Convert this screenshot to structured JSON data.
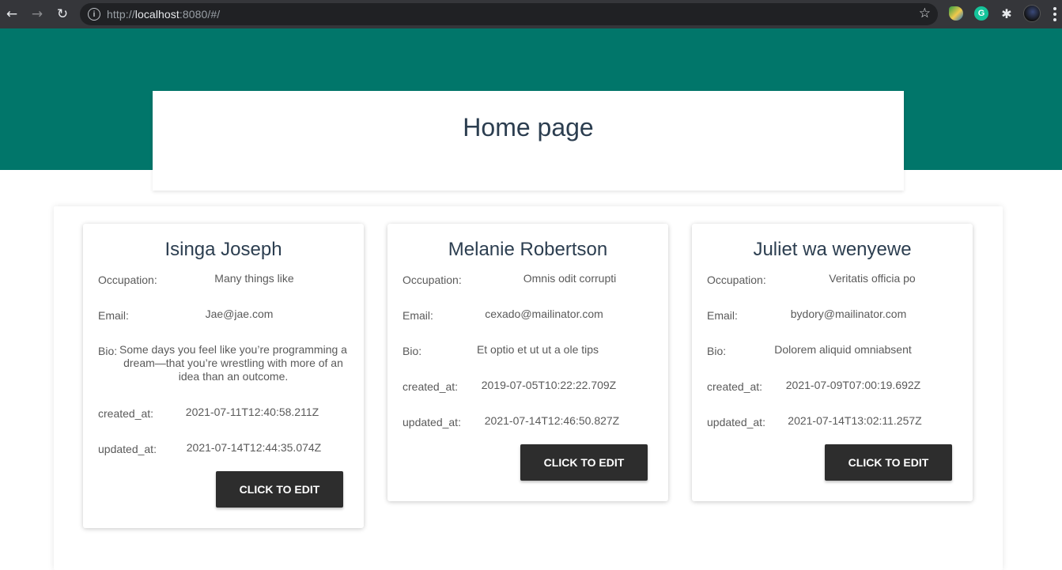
{
  "browser": {
    "url_scheme": "http://",
    "url_host": "localhost",
    "url_rest": ":8080/#/"
  },
  "colors": {
    "hero": "#01766a",
    "title_text": "#2c3e50",
    "button": "#2d2d2d"
  },
  "page": {
    "title": "Home page"
  },
  "labels": {
    "occupation": "Occupation:",
    "email": "Email:",
    "bio": "Bio:",
    "created_at": "created_at:",
    "updated_at": "updated_at:",
    "edit_button": "CLICK TO EDIT"
  },
  "users": [
    {
      "name": "Isinga Joseph",
      "occupation": "Many things like",
      "email": "Jae@jae.com",
      "bio": "Some days you feel like you’re programming a dream—that you’re wrestling with more of an idea than an outcome.",
      "created_at": "2021-07-11T12:40:58.211Z",
      "updated_at": "2021-07-14T12:44:35.074Z"
    },
    {
      "name": "Melanie Robertson",
      "occupation": "Omnis odit corrupti",
      "email": "cexado@mailinator.com",
      "bio": "Et optio et ut ut a ole tips",
      "created_at": "2019-07-05T10:22:22.709Z",
      "updated_at": "2021-07-14T12:46:50.827Z"
    },
    {
      "name": "Juliet wa wenyewe",
      "occupation": "Veritatis officia po",
      "email": "bydory@mailinator.com",
      "bio": "Dolorem aliquid omniabsent",
      "created_at": "2021-07-09T07:00:19.692Z",
      "updated_at": "2021-07-14T13:02:11.257Z"
    }
  ]
}
